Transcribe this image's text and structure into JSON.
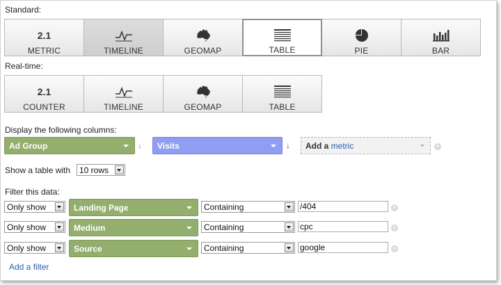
{
  "standard": {
    "label": "Standard:",
    "buttons": [
      {
        "label": "METRIC",
        "icon": "2.1"
      },
      {
        "label": "TIMELINE"
      },
      {
        "label": "GEOMAP"
      },
      {
        "label": "TABLE"
      },
      {
        "label": "PIE"
      },
      {
        "label": "BAR"
      }
    ]
  },
  "realtime": {
    "label": "Real-time:",
    "buttons": [
      {
        "label": "COUNTER",
        "icon": "2.1"
      },
      {
        "label": "TIMELINE"
      },
      {
        "label": "GEOMAP"
      },
      {
        "label": "TABLE"
      }
    ]
  },
  "columns": {
    "label": "Display the following columns:",
    "dimension": "Ad Group",
    "metric": "Visits",
    "add_prefix": "Add a ",
    "add_link": "metric"
  },
  "show": {
    "label": "Show a table with",
    "value": "10 rows"
  },
  "filters": {
    "label": "Filter this data:",
    "rows": [
      {
        "mode": "Only show",
        "dimension": "Landing Page",
        "match": "Containing",
        "value": "/404"
      },
      {
        "mode": "Only show",
        "dimension": "Medium",
        "match": "Containing",
        "value": "cpc"
      },
      {
        "mode": "Only show",
        "dimension": "Source",
        "match": "Containing",
        "value": "google"
      }
    ],
    "add_label": "Add a filter"
  },
  "colors": {
    "dimension_green": "#93ae6d",
    "metric_blue": "#8f9ef1",
    "link_blue": "#2a5db0"
  }
}
